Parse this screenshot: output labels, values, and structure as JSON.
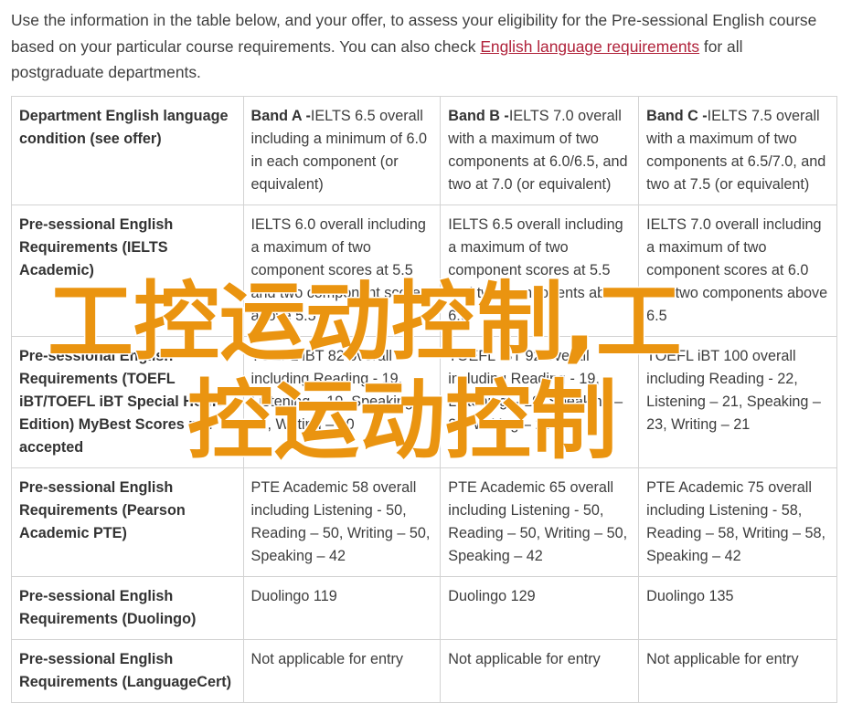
{
  "intro": {
    "text_before": "Use the information in the table below, and your offer, to assess your eligibility for the Pre-sessional English course based on your particular course requirements. You can also check ",
    "link": "English language requirements",
    "text_after": " for all postgraduate departments."
  },
  "table": {
    "header": {
      "label": "Department English language condition (see offer)",
      "bands": [
        {
          "name": "Band A -",
          "desc": "IELTS 6.5 overall including a minimum of 6.0 in each component (or equivalent)"
        },
        {
          "name": "Band B -",
          "desc": "IELTS 7.0 overall with a maximum of two components at 6.0/6.5, and two at 7.0 (or equivalent)"
        },
        {
          "name": "Band C -",
          "desc": "IELTS 7.5 overall with a maximum of two components at 6.5/7.0, and two at 7.5 (or equivalent)"
        }
      ]
    },
    "rows": [
      {
        "label": "Pre-sessional English Requirements (IELTS Academic)",
        "cells": [
          "IELTS 6.0 overall including a maximum of two component scores at 5.5 and two component scores above 5.5",
          "IELTS 6.5 overall including a maximum of two component scores at 5.5 and two components above 6.0",
          "IELTS 7.0 overall including a maximum of two component scores at 6.0 and two components above 6.5"
        ]
      },
      {
        "label": "Pre-sessional English Requirements (TOEFL iBT/TOEFL iBT Special Home Edition) MyBest Scores not accepted",
        "cells": [
          "TOEFL iBT 82 overall including Reading - 19, Listening – 19, Speaking – 22, Writing – 20",
          "TOEFL iBT 92 overall including Reading - 19, Listening – 19, Speaking – 22, Writing – 20",
          "TOEFL iBT 100 overall including Reading - 22, Listening – 21, Speaking – 23, Writing – 21"
        ]
      },
      {
        "label": "Pre-sessional English Requirements (Pearson Academic PTE)",
        "cells": [
          "PTE Academic 58 overall including Listening - 50, Reading – 50, Writing – 50, Speaking – 42",
          "PTE Academic 65 overall including Listening - 50, Reading – 50, Writing – 50, Speaking – 42",
          "PTE Academic 75 overall including Listening - 58, Reading – 58, Writing – 58, Speaking – 42"
        ]
      },
      {
        "label": "Pre-sessional English Requirements (Duolingo)",
        "cells": [
          "Duolingo 119",
          "Duolingo 129",
          "Duolingo 135"
        ]
      },
      {
        "label": "Pre-sessional English Requirements (LanguageCert)",
        "cells": [
          "Not applicable for entry",
          "Not applicable for entry",
          "Not applicable for entry"
        ]
      }
    ]
  },
  "watermark": {
    "line1": "工控运动控制,工",
    "line2": "控运动控制",
    "color": "#ea9410"
  }
}
